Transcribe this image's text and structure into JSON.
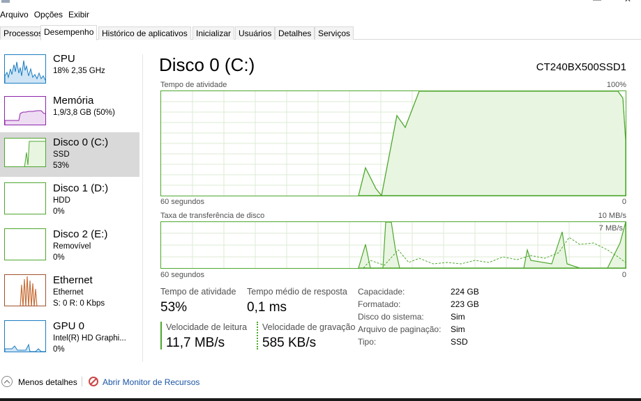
{
  "menu": [
    "Arquivo",
    "Opções",
    "Exibir"
  ],
  "tabs": [
    "Processos",
    "Desempenho",
    "Histórico de aplicativos",
    "Inicializar",
    "Usuários",
    "Detalhes",
    "Serviços"
  ],
  "active_tab": "Desempenho",
  "sidebar": {
    "items": [
      {
        "name": "CPU",
        "line2": "18% 2,35 GHz",
        "line3": "",
        "color": "#1b7cc1",
        "selected": false
      },
      {
        "name": "Memória",
        "line2": "1,9/3,8 GB (50%)",
        "line3": "",
        "color": "#8e24aa",
        "selected": false
      },
      {
        "name": "Disco 0 (C:)",
        "line2": "SSD",
        "line3": "53%",
        "color": "#4ea72e",
        "selected": true
      },
      {
        "name": "Disco 1 (D:)",
        "line2": "HDD",
        "line3": "0%",
        "color": "#4ea72e",
        "selected": false
      },
      {
        "name": "Disco 2 (E:)",
        "line2": "Removível",
        "line3": "0%",
        "color": "#4ea72e",
        "selected": false
      },
      {
        "name": "Ethernet",
        "line2": "Ethernet",
        "line3": "S: 0 R: 0 Kbps",
        "color": "#a0522d",
        "selected": false
      },
      {
        "name": "GPU 0",
        "line2": "Intel(R) HD Graphi...",
        "line3": "0%",
        "color": "#1b7cc1",
        "selected": false
      }
    ]
  },
  "main": {
    "title": "Disco 0 (C:)",
    "model": "CT240BX500SSD1",
    "graph1": {
      "label": "Tempo de atividade",
      "max_label": "100%",
      "time_label": "60 segundos",
      "zero_label": "0"
    },
    "graph2": {
      "label": "Taxa de transferência de disco",
      "max_label": "10 MB/s",
      "inner_label": "7 MB/s",
      "time_label": "60 segundos",
      "zero_label": "0"
    },
    "stats": {
      "active_time_label": "Tempo de atividade",
      "active_time_value": "53%",
      "response_label": "Tempo médio de resposta",
      "response_value": "0,1 ms",
      "read_label": "Velocidade de leitura",
      "read_value": "11,7 MB/s",
      "write_label": "Velocidade de gravação",
      "write_value": "585 KB/s"
    },
    "info": [
      {
        "label": "Capacidade:",
        "value": "224 GB"
      },
      {
        "label": "Formatado:",
        "value": "223 GB"
      },
      {
        "label": "Disco do sistema:",
        "value": "Sim"
      },
      {
        "label": "Arquivo de paginação:",
        "value": "Sim"
      },
      {
        "label": "Tipo:",
        "value": "SSD"
      }
    ]
  },
  "footer": {
    "less_details": "Menos detalhes",
    "open_monitor": "Abrir Monitor de Recursos"
  },
  "colors": {
    "disk": "#4ea72e",
    "disk_fill": "#e8f5e1",
    "grid": "#dcebd3",
    "selected_bg": "#d9d9d9",
    "link": "#1a55a6"
  }
}
